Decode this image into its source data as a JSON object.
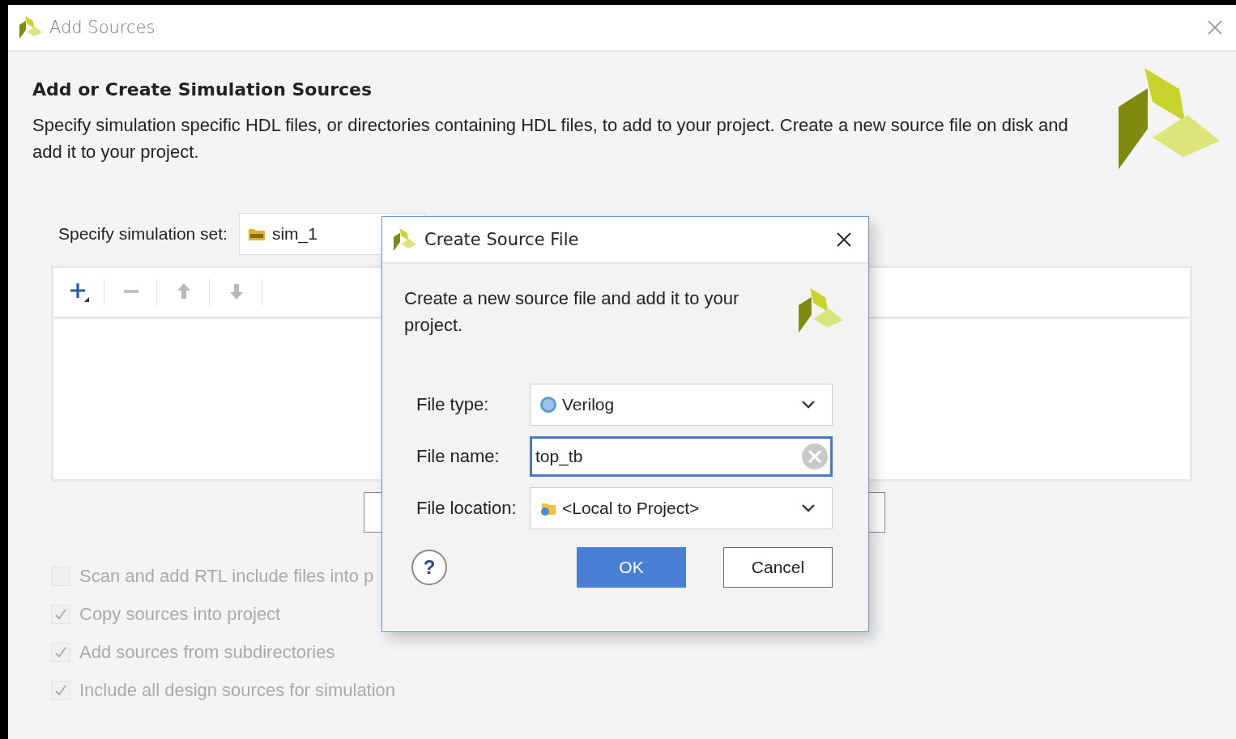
{
  "window": {
    "title": "Add Sources"
  },
  "page": {
    "heading": "Add or Create Simulation Sources",
    "description": "Specify simulation specific HDL files, or directories containing HDL files, to add to your project. Create a new source file on disk and add it to your project."
  },
  "simulation_set": {
    "label": "Specify simulation set:",
    "value": "sim_1"
  },
  "toolbar": [
    {
      "kind": "add",
      "disabled": false
    },
    {
      "kind": "remove",
      "disabled": true
    },
    {
      "kind": "up",
      "disabled": true
    },
    {
      "kind": "down",
      "disabled": true
    }
  ],
  "options": [
    {
      "label": "Scan and add RTL include files into p",
      "checked": false,
      "disabled": true
    },
    {
      "label": "Copy sources into project",
      "checked": true,
      "disabled": true
    },
    {
      "label": "Add sources from subdirectories",
      "checked": true,
      "disabled": true
    },
    {
      "label": "Include all design sources for simulation",
      "checked": true,
      "disabled": true
    }
  ],
  "dialog": {
    "title": "Create Source File",
    "description": "Create a new source file and add it to your project.",
    "fields": [
      {
        "kind": "filetype",
        "label": "File type:",
        "value": "Verilog"
      },
      {
        "kind": "text",
        "label": "File name:",
        "value": "top_tb",
        "focused": true
      },
      {
        "kind": "location",
        "label": "File location:",
        "value": "<Local to Project>"
      }
    ],
    "help": "?",
    "buttons": [
      {
        "label": "OK",
        "primary": true
      },
      {
        "label": "Cancel",
        "primary": false
      }
    ]
  }
}
